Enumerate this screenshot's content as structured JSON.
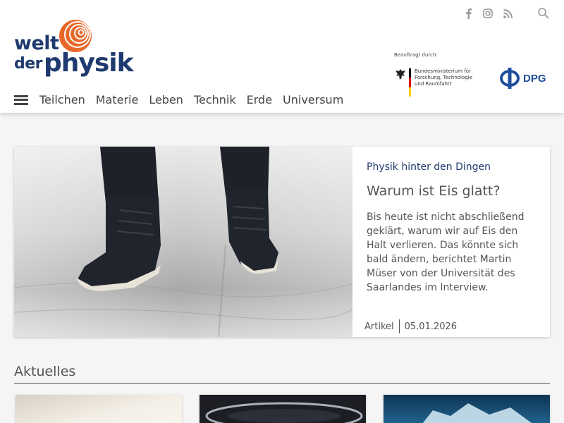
{
  "site": {
    "logo_line1": "welt",
    "logo_line2": "der",
    "logo_line3": "physik"
  },
  "header": {
    "social_icons": [
      "facebook-icon",
      "instagram-icon",
      "rss-icon"
    ],
    "search_icon": "search-icon",
    "sponsor_label": "Beauftragt durch:",
    "bmbf_text": "Bundesministerium für Forschung, Technologie und Raumfahrt",
    "dpg_text": "DPG"
  },
  "nav": {
    "items": [
      "Teilchen",
      "Materie",
      "Leben",
      "Technik",
      "Erde",
      "Universum"
    ]
  },
  "feature": {
    "kicker": "Physik hinter den Dingen",
    "title": "Warum ist Eis glatt?",
    "text": "Bis heute ist nicht abschließend geklärt, warum wir auf Eis den Halt verlieren. Das könnte sich bald ändern, berichtet Martin Müser von der Universität des Saarlandes im Interview.",
    "type": "Artikel",
    "date": "05.01.2026"
  },
  "aktuelles": {
    "title": "Aktuelles"
  },
  "colors": {
    "brand_blue": "#1f3a6e",
    "brand_orange": "#e8682a",
    "text_gray": "#555555"
  }
}
